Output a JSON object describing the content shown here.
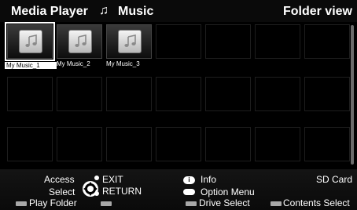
{
  "header": {
    "title": "Media Player",
    "section": "Music",
    "view_mode": "Folder view"
  },
  "grid": {
    "selected_index": 0,
    "tiles": [
      {
        "label": "My Music_1",
        "filled": true
      },
      {
        "label": "My Music_2",
        "filled": true
      },
      {
        "label": "My Music_3",
        "filled": true
      },
      {
        "label": "",
        "filled": false
      },
      {
        "label": "",
        "filled": false
      },
      {
        "label": "",
        "filled": false
      },
      {
        "label": "",
        "filled": false
      },
      {
        "label": "",
        "filled": false
      },
      {
        "label": "",
        "filled": false
      },
      {
        "label": "",
        "filled": false
      },
      {
        "label": "",
        "filled": false
      },
      {
        "label": "",
        "filled": false
      },
      {
        "label": "",
        "filled": false
      },
      {
        "label": "",
        "filled": false
      },
      {
        "label": "",
        "filled": false
      },
      {
        "label": "",
        "filled": false
      },
      {
        "label": "",
        "filled": false
      },
      {
        "label": "",
        "filled": false
      },
      {
        "label": "",
        "filled": false
      },
      {
        "label": "",
        "filled": false
      },
      {
        "label": "",
        "filled": false
      }
    ]
  },
  "footer": {
    "access_label": "Access",
    "select_label": "Select",
    "exit_label": "EXIT",
    "return_label": "RETURN",
    "info_label": "Info",
    "info_badge": "i",
    "option_label": "Option Menu",
    "sd_card_label": "SD Card",
    "play_folder_label": "Play Folder",
    "drive_select_label": "Drive Select",
    "contents_select_label": "Contents Select"
  },
  "colors": {
    "background": "#000000",
    "text": "#ffffff",
    "color_key": "#a8a8a8"
  },
  "icons": {
    "music_note": "music-note-icon",
    "dpad": "dpad-icon",
    "info_badge": "info-badge-icon",
    "option_badge": "option-badge-icon"
  }
}
